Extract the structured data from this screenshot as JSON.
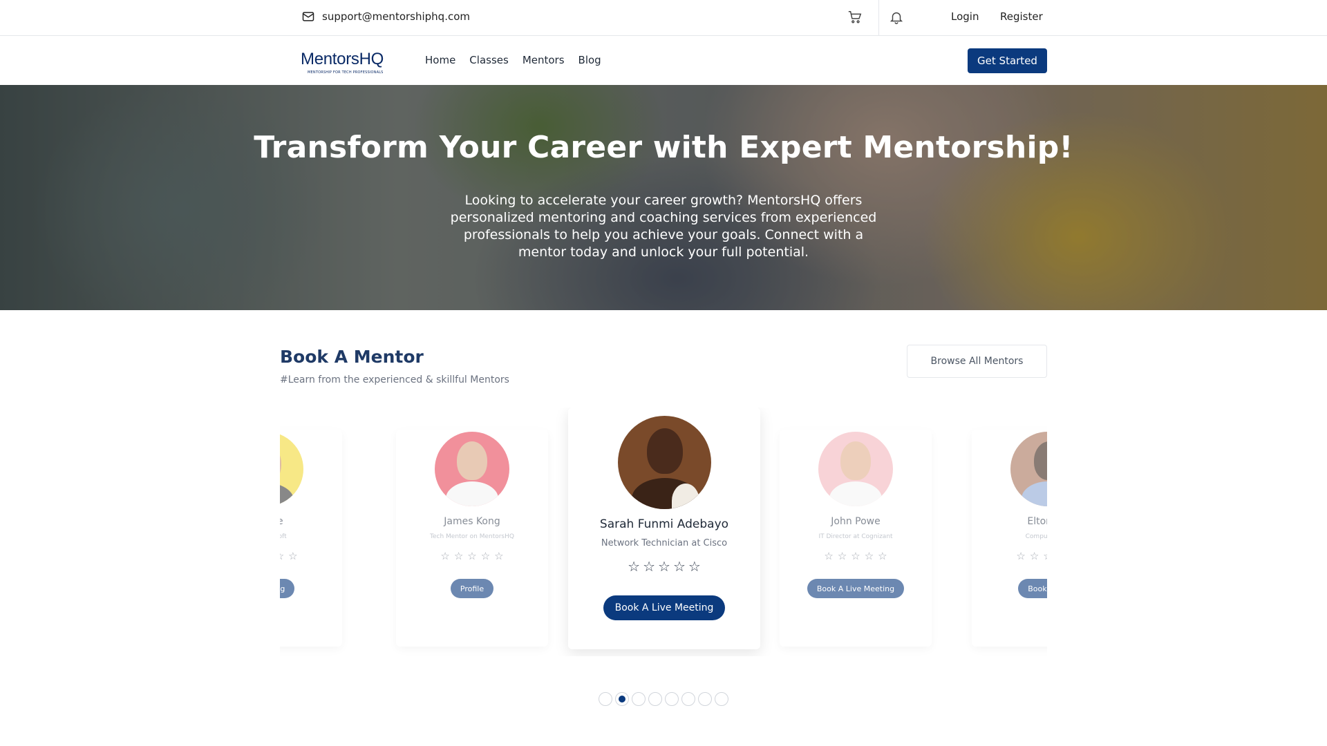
{
  "topbar": {
    "email": "support@mentorshiphq.com",
    "login": "Login",
    "register": "Register"
  },
  "nav": {
    "logo_name": "MentorsHQ",
    "logo_tagline": "MENTORSHIP FOR TECH PROFESSIONALS",
    "links": [
      "Home",
      "Classes",
      "Mentors",
      "Blog"
    ],
    "cta": "Get Started"
  },
  "hero": {
    "title": "Transform Your Career with Expert Mentorship!",
    "subtitle": "Looking to accelerate your career growth? MentorsHQ offers personalized mentoring and coaching services from experienced professionals to help you achieve your goals. Connect with a mentor today and unlock your full potential."
  },
  "section": {
    "title": "Book A Mentor",
    "subtitle": "#Learn from the experienced & skillful Mentors",
    "browse_button": "Browse All Mentors"
  },
  "mentors": [
    {
      "name": "o Dave",
      "role": "r at Microsoft",
      "button": "e Meeting",
      "stars": 5
    },
    {
      "name": "James Kong",
      "role": "Tech Mentor on MentorsHQ",
      "button": "Profile",
      "stars": 5
    },
    {
      "name": "Sarah Funmi Adebayo",
      "role": "Network Technician at Cisco",
      "button": "Book A Live Meeting",
      "stars": 5
    },
    {
      "name": "John Powe",
      "role": "IT Director at Cognizant",
      "button": "Book A Live Meeting",
      "stars": 5
    },
    {
      "name": "Elton Ha",
      "role": "Computer Eng",
      "button": "Book A Liv",
      "stars": 5
    }
  ],
  "carousel": {
    "dot_count": 8,
    "active_dot": 2
  },
  "colors": {
    "primary": "#0b3a7e",
    "heading": "#1f3a66"
  }
}
